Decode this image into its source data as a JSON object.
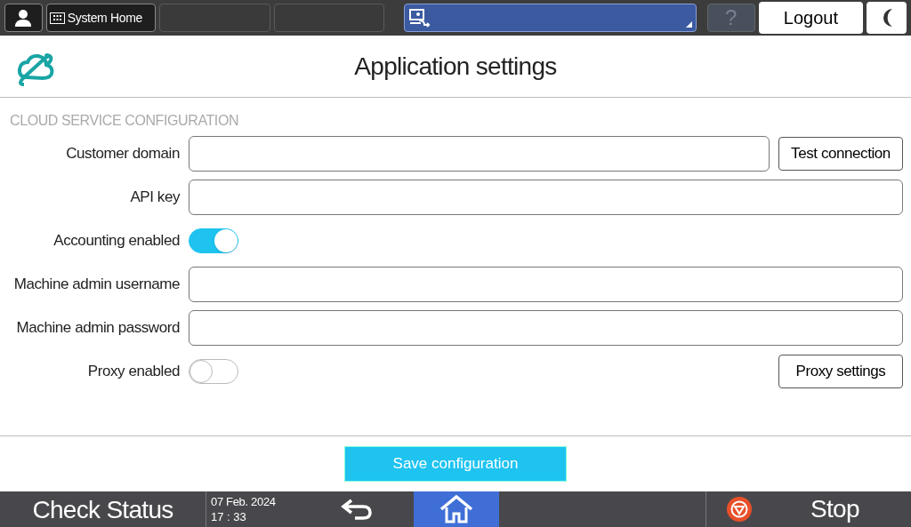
{
  "top_bar": {
    "home_label": "System Home",
    "help": {
      "label": "?",
      "disabled": true
    },
    "logout": "Logout"
  },
  "header": {
    "title": "Application settings"
  },
  "section": {
    "heading": "CLOUD SERVICE CONFIGURATION",
    "rows": [
      {
        "kind": "input",
        "label": "Customer domain",
        "button": "Test connection"
      },
      {
        "kind": "input",
        "label": "API key"
      },
      {
        "kind": "toggle",
        "label": "Accounting enabled",
        "on": true
      },
      {
        "kind": "input",
        "label": "Machine admin username"
      },
      {
        "kind": "input",
        "label": "Machine admin password"
      },
      {
        "kind": "toggle",
        "label": "Proxy enabled",
        "on": false,
        "button": "Proxy settings"
      }
    ]
  },
  "save_button": "Save configuration",
  "bottom_bar": {
    "check_status": "Check Status",
    "date": "07 Feb. 2024",
    "time": "17 : 33",
    "stop": "Stop"
  }
}
